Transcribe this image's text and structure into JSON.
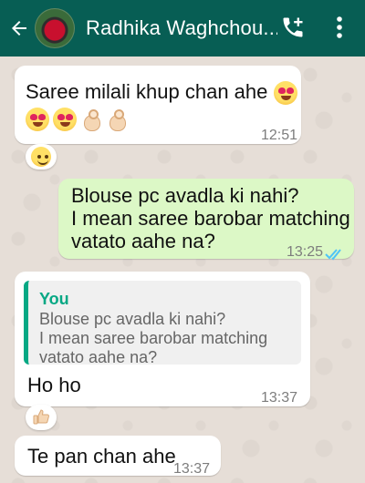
{
  "header": {
    "title": "Radhika Waghchou...",
    "back_icon": "back-arrow-icon",
    "call_icon": "add-call-icon",
    "menu_icon": "more-vert-icon"
  },
  "colors": {
    "header": "#075e54",
    "incoming": "#ffffff",
    "outgoing": "#dcf8c6",
    "quote_accent": "#06a884",
    "read_ticks": "#4fc3f7"
  },
  "messages": [
    {
      "direction": "incoming",
      "text": "Saree milali khup chan ahe",
      "emojis": [
        "heart-eyes-emoji",
        "heart-eyes-emoji",
        "heart-eyes-emoji",
        "ok-hand-emoji",
        "ok-hand-emoji"
      ],
      "time": "12:51",
      "reaction": "smile-emoji"
    },
    {
      "direction": "outgoing",
      "text": "Blouse pc avadla ki nahi?\nI mean saree barobar matching\nvatato aahe na?",
      "line1": "Blouse pc avadla ki nahi?",
      "line2": "I mean saree barobar matching",
      "line3": "vatato aahe na?",
      "time": "13:25",
      "status": "read"
    },
    {
      "direction": "incoming",
      "quote_author": "You",
      "quote_text": "Blouse pc avadla ki nahi?\nI mean saree barobar matching\nvatato aahe na?",
      "text": "Ho ho",
      "time": "13:37",
      "reaction": "thumbs-up-emoji"
    },
    {
      "direction": "incoming",
      "text": "Te pan chan ahe",
      "time": "13:37"
    }
  ]
}
